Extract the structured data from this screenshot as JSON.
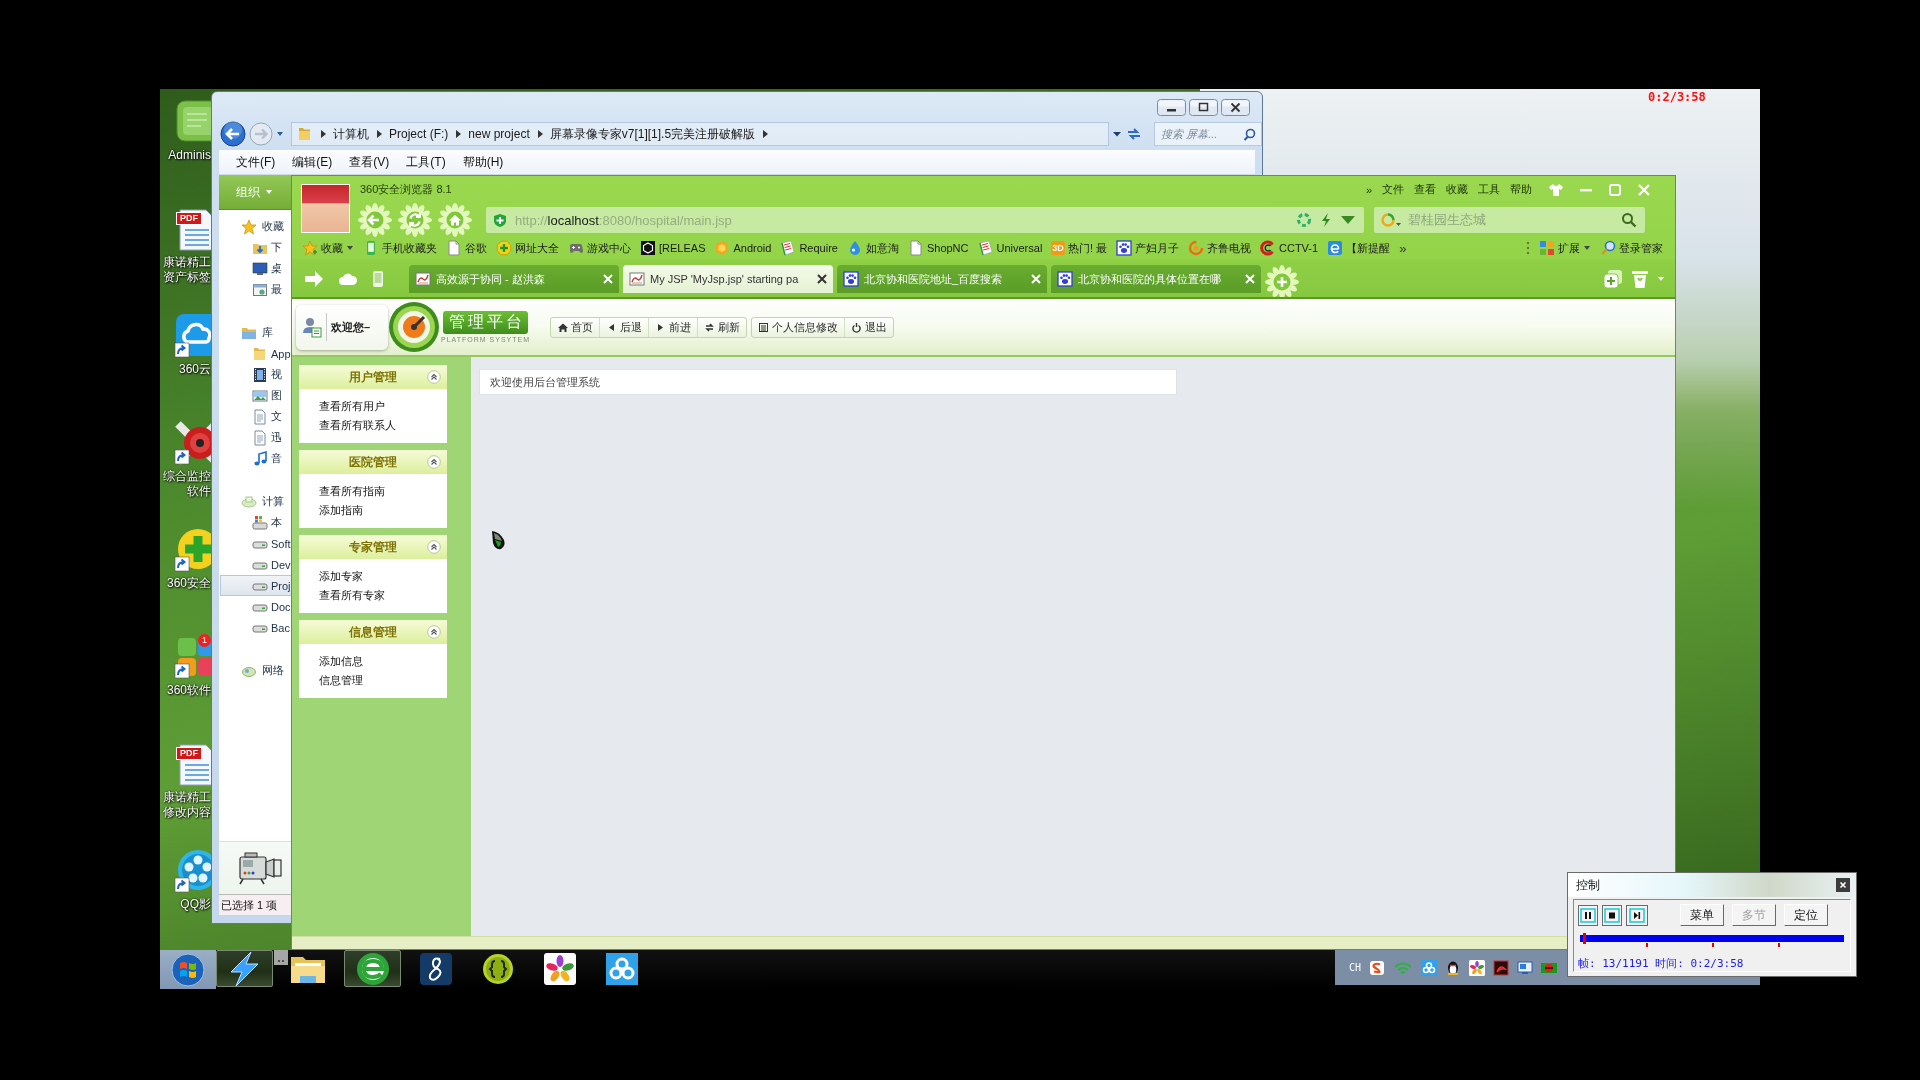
{
  "recording_timer": "0:2/3:58",
  "desktop_icons": [
    {
      "kind": "app",
      "lines": [
        "Adminis"
      ]
    },
    {
      "kind": "pdf",
      "badge": "PDF",
      "lines": [
        "康诺精工",
        "资产标签"
      ]
    },
    {
      "kind": "cloud",
      "lines": [
        "360云"
      ]
    },
    {
      "kind": "disc",
      "lines": [
        "综合监控",
        "软件"
      ]
    },
    {
      "kind": "plus",
      "lines": [
        "360安全"
      ]
    },
    {
      "kind": "tiles",
      "badge": "1",
      "lines": [
        "360软件"
      ]
    },
    {
      "kind": "pdf",
      "badge": "PDF",
      "lines": [
        "康诺精工",
        "修改内容"
      ]
    },
    {
      "kind": "reel",
      "lines": [
        "QQ影"
      ]
    }
  ],
  "explorer": {
    "breadcrumb": [
      "计算机",
      "Project (F:)",
      "new project",
      "屏幕录像专家v7[1][1].5完美注册破解版"
    ],
    "search": {
      "placeholder": "搜索 屏幕..."
    },
    "menu": [
      "文件(F)",
      "编辑(E)",
      "查看(V)",
      "工具(T)",
      "帮助(H)"
    ],
    "organize": "组织",
    "nav": [
      {
        "label": "收藏",
        "kind": "star",
        "selected": false,
        "children": [
          {
            "label": "下",
            "kind": "download",
            "selected": false
          },
          {
            "label": "桌",
            "kind": "desktop",
            "selected": false
          },
          {
            "label": "最",
            "kind": "recent",
            "selected": false
          }
        ]
      },
      {
        "label": "库",
        "kind": "library",
        "selected": false,
        "children": [
          {
            "label": "App",
            "kind": "folder",
            "selected": false
          },
          {
            "label": "视",
            "kind": "film",
            "selected": false
          },
          {
            "label": "图",
            "kind": "picture",
            "selected": false
          },
          {
            "label": "文",
            "kind": "document",
            "selected": false
          },
          {
            "label": "迅",
            "kind": "document",
            "selected": false
          },
          {
            "label": "音",
            "kind": "music",
            "selected": false
          }
        ]
      },
      {
        "label": "计算",
        "kind": "computer",
        "selected": false,
        "children": [
          {
            "label": "本",
            "kind": "system-drive",
            "selected": false
          },
          {
            "label": "Soft",
            "kind": "drive",
            "selected": false
          },
          {
            "label": "Dev",
            "kind": "drive",
            "selected": false
          },
          {
            "label": "Proj",
            "kind": "drive",
            "selected": true
          },
          {
            "label": "Doc",
            "kind": "drive",
            "selected": false
          },
          {
            "label": "Bac",
            "kind": "drive",
            "selected": false
          }
        ]
      },
      {
        "label": "网络",
        "kind": "network",
        "selected": false
      }
    ],
    "status": "已选择 1 项"
  },
  "browser": {
    "title": "360安全浏览器 8.1",
    "menu_more": "»",
    "menu": [
      "文件",
      "查看",
      "收藏",
      "工具",
      "帮助"
    ],
    "url": {
      "scheme": "http://",
      "host": "localhost",
      "rest": ":8080/hospital/main.jsp"
    },
    "search": {
      "placeholder": "碧桂园生态城"
    },
    "bookmarks": [
      {
        "label": "收藏",
        "kind": "star"
      },
      {
        "label": "手机收藏夹",
        "kind": "phone"
      },
      {
        "label": "谷歌",
        "kind": "page"
      },
      {
        "label": "网址大全",
        "kind": "plus"
      },
      {
        "label": "游戏中心",
        "kind": "gamepad"
      },
      {
        "label": "[RELEAS",
        "kind": "cube"
      },
      {
        "label": "Android",
        "kind": "hexagon"
      },
      {
        "label": "Require",
        "kind": "book"
      },
      {
        "label": "如意淘",
        "kind": "drop"
      },
      {
        "label": "ShopNC",
        "kind": "page"
      },
      {
        "label": "Universal",
        "kind": "book"
      },
      {
        "label": "热门! 最",
        "kind": "tile",
        "badge": "3D"
      },
      {
        "label": "产妇月子",
        "kind": "paw"
      },
      {
        "label": "齐鲁电视",
        "kind": "swirl"
      },
      {
        "label": "CCTV-1",
        "kind": "ring"
      },
      {
        "label": "【新提醒",
        "kind": "etile"
      }
    ],
    "bookmarks_more": "»",
    "extensions": "扩展",
    "account": "登录管家",
    "tabs": [
      {
        "title": "高效源于协同 - 赵洪森",
        "kind": "image",
        "selected": false
      },
      {
        "title": "My JSP 'MyJsp.jsp' starting pa",
        "kind": "image",
        "selected": true
      },
      {
        "title": "北京协和医院地址_百度搜索",
        "kind": "paw",
        "selected": false
      },
      {
        "title": "北京协和医院的具体位置在哪",
        "kind": "paw",
        "selected": false
      }
    ],
    "page": {
      "welcome": "欢迎您–",
      "logo_title": "管理平台",
      "logo_subtitle": "PLATFORM SYSYTEM",
      "nav": [
        {
          "label": "首页",
          "kind": "home"
        },
        {
          "label": "后退",
          "kind": "back"
        },
        {
          "label": "前进",
          "kind": "forward"
        },
        {
          "label": "刷新",
          "kind": "refresh"
        }
      ],
      "account_nav": [
        {
          "label": "个人信息修改",
          "kind": "list"
        },
        {
          "label": "退出",
          "kind": "power"
        }
      ],
      "menu_groups": [
        {
          "title": "用户管理",
          "expanded": true,
          "items": [
            "查看所有用户",
            "查看所有联系人"
          ]
        },
        {
          "title": "医院管理",
          "expanded": true,
          "items": [
            "查看所有指南",
            "添加指南"
          ]
        },
        {
          "title": "专家管理",
          "expanded": true,
          "items": [
            "添加专家",
            "查看所有专家"
          ]
        },
        {
          "title": "信息管理",
          "expanded": true,
          "items": [
            "添加信息",
            "信息管理"
          ]
        }
      ],
      "content_title": "欢迎使用后台管理系统"
    }
  },
  "taskbar": {
    "apps": [
      {
        "kind": "bolt",
        "active": true
      },
      {
        "kind": "stub",
        "active": false
      },
      {
        "kind": "folder",
        "active": false
      },
      {
        "kind": "globe",
        "active": true
      },
      {
        "kind": "script",
        "active": false
      },
      {
        "kind": "braces",
        "active": false
      },
      {
        "kind": "pinwheel",
        "active": false
      },
      {
        "kind": "cloud",
        "active": false
      }
    ],
    "language": "CH"
  },
  "control": {
    "title": "控制",
    "buttons": [
      {
        "label": "菜单",
        "disabled": false
      },
      {
        "label": "多节",
        "disabled": true
      },
      {
        "label": "定位",
        "disabled": false
      }
    ],
    "level": 0.011,
    "status": "帧: 13/1191 时间: 0:2/3:58"
  }
}
